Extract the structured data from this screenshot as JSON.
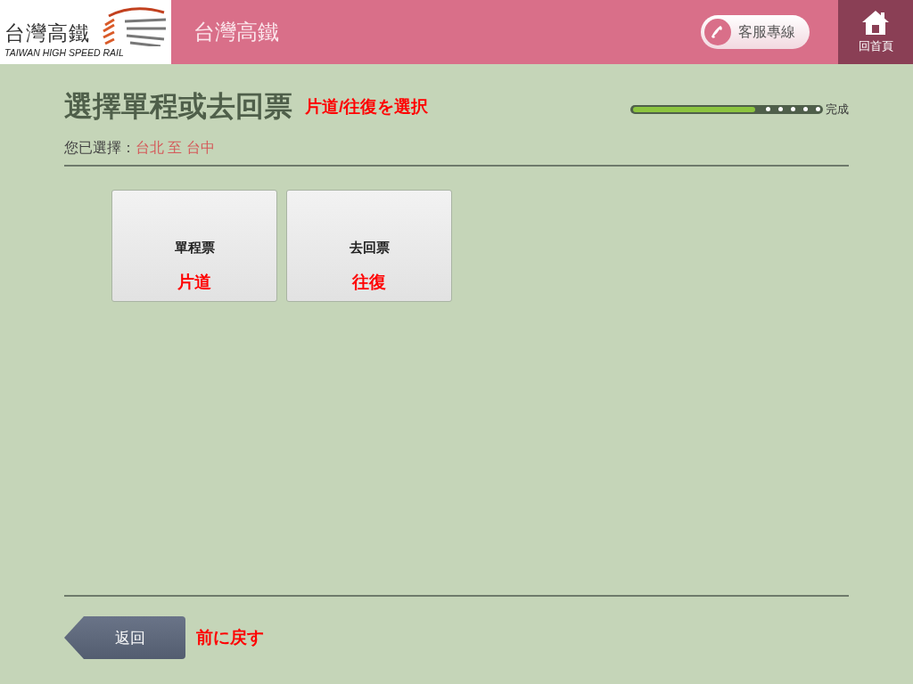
{
  "header": {
    "logo_text": "台灣高鐵",
    "logo_subtext": "TAIWAN HIGH SPEED RAIL",
    "title": "台灣高鐵",
    "service_button": "客服專線",
    "home_button": "回首頁"
  },
  "page": {
    "title": "選擇單程或去回票",
    "title_note": "片道/往復を選択",
    "progress": {
      "level": 0.65,
      "end_label": "完成"
    },
    "selection": {
      "label": "您已選擇：",
      "value": "台北 至 台中"
    },
    "options": [
      {
        "label": "單程票",
        "note": "片道"
      },
      {
        "label": "去回票",
        "note": "往復"
      }
    ],
    "back_button": {
      "label": "返回",
      "note": "前に戻す"
    }
  }
}
